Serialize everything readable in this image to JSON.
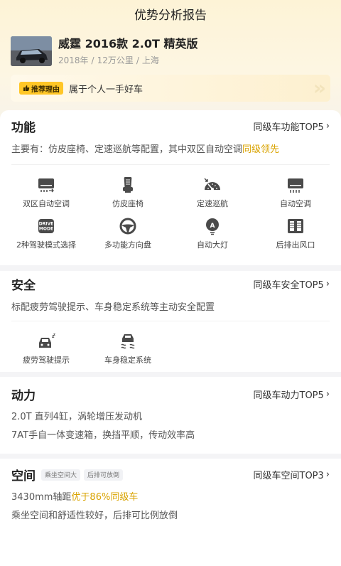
{
  "header": {
    "title": "优势分析报告"
  },
  "car": {
    "name": "威霆 2016款 2.0T 精英版",
    "year": "2018年",
    "mileage": "12万公里",
    "city": "上海",
    "sep": "/"
  },
  "reason": {
    "badge": "推荐理由",
    "text": "属于个人一手好车"
  },
  "function": {
    "title": "功能",
    "link": "同级车功能TOP5",
    "desc_prefix": "主要有：仿皮座椅、定速巡航等配置，其中双区自动空调",
    "desc_highlight": "同级领先",
    "features": [
      {
        "label": "双区自动空调",
        "icon": "dual-zone-ac-icon"
      },
      {
        "label": "仿皮座椅",
        "icon": "leather-seat-icon"
      },
      {
        "label": "定速巡航",
        "icon": "cruise-control-icon"
      },
      {
        "label": "自动空调",
        "icon": "auto-ac-icon"
      },
      {
        "label": "2种驾驶模式选择",
        "icon": "drive-mode-icon"
      },
      {
        "label": "多功能方向盘",
        "icon": "steering-wheel-icon"
      },
      {
        "label": "自动大灯",
        "icon": "auto-headlight-icon"
      },
      {
        "label": "后排出风口",
        "icon": "rear-vent-icon"
      }
    ]
  },
  "safety": {
    "title": "安全",
    "link": "同级车安全TOP5",
    "desc": "标配疲劳驾驶提示、车身稳定系统等主动安全配置",
    "features": [
      {
        "label": "疲劳驾驶提示",
        "icon": "fatigue-warning-icon"
      },
      {
        "label": "车身稳定系统",
        "icon": "stability-control-icon"
      }
    ]
  },
  "power": {
    "title": "动力",
    "link": "同级车动力TOP5",
    "line1": "2.0T 直列4缸，涡轮增压发动机",
    "line2": "7AT手自一体变速箱，换挡平顺，传动效率高"
  },
  "space": {
    "title": "空间",
    "tag1": "乘坐空间大",
    "tag2": "后排可放倒",
    "link": "同级车空间TOP3",
    "line1_prefix": "3430mm轴距",
    "line1_highlight": "优于86%同级车",
    "line2": "乘坐空间和舒适性较好，后排可比例放倒"
  },
  "chevron": "›",
  "accent": "#ffc626",
  "highlight_color": "#d9a300",
  "icon_color": "#4a4a4a"
}
